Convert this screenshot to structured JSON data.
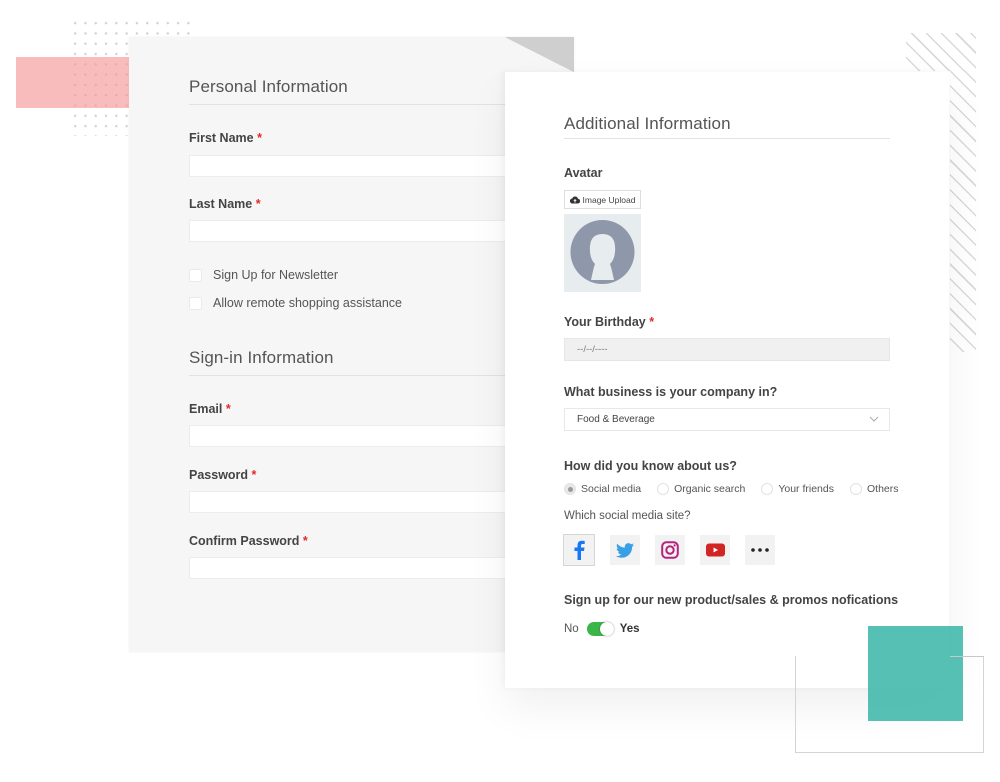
{
  "personal": {
    "title": "Personal Information",
    "first_name_label": "First Name",
    "last_name_label": "Last Name",
    "required_mark": "*",
    "first_name_value": "",
    "last_name_value": "",
    "checkboxes": [
      {
        "label": "Sign Up for Newsletter",
        "checked": false
      },
      {
        "label": "Allow remote shopping assistance",
        "checked": false
      }
    ]
  },
  "signin": {
    "title": "Sign-in Information",
    "email_label": "Email",
    "password_label": "Password",
    "confirm_label": "Confirm Password",
    "email_value": "",
    "password_value": "",
    "confirm_value": ""
  },
  "additional": {
    "title": "Additional Information",
    "avatar_label": "Avatar",
    "upload_label": "Image Upload",
    "birthday_label": "Your Birthday",
    "birthday_placeholder": "--/--/----",
    "business_label": "What business is your company in?",
    "business_value": "Food & Beverage",
    "source_label": "How did you know about us?",
    "source_options": [
      {
        "label": "Social media",
        "selected": true
      },
      {
        "label": "Organic search",
        "selected": false
      },
      {
        "label": "Your friends",
        "selected": false
      },
      {
        "label": "Others",
        "selected": false
      }
    ],
    "social_label": "Which social media site?",
    "social_sites": [
      {
        "name": "facebook",
        "selected": true
      },
      {
        "name": "twitter",
        "selected": false
      },
      {
        "name": "instagram",
        "selected": false
      },
      {
        "name": "youtube",
        "selected": false
      },
      {
        "name": "more",
        "selected": false
      }
    ],
    "notify_label": "Sign up for our new product/sales & promos nofications",
    "toggle_off_label": "No",
    "toggle_on_label": "Yes",
    "toggle_on": true
  },
  "colors": {
    "required": "#e02b2b",
    "toggle": "#3bb54a",
    "teal": "#40b7aa",
    "pink": "#f49898"
  }
}
